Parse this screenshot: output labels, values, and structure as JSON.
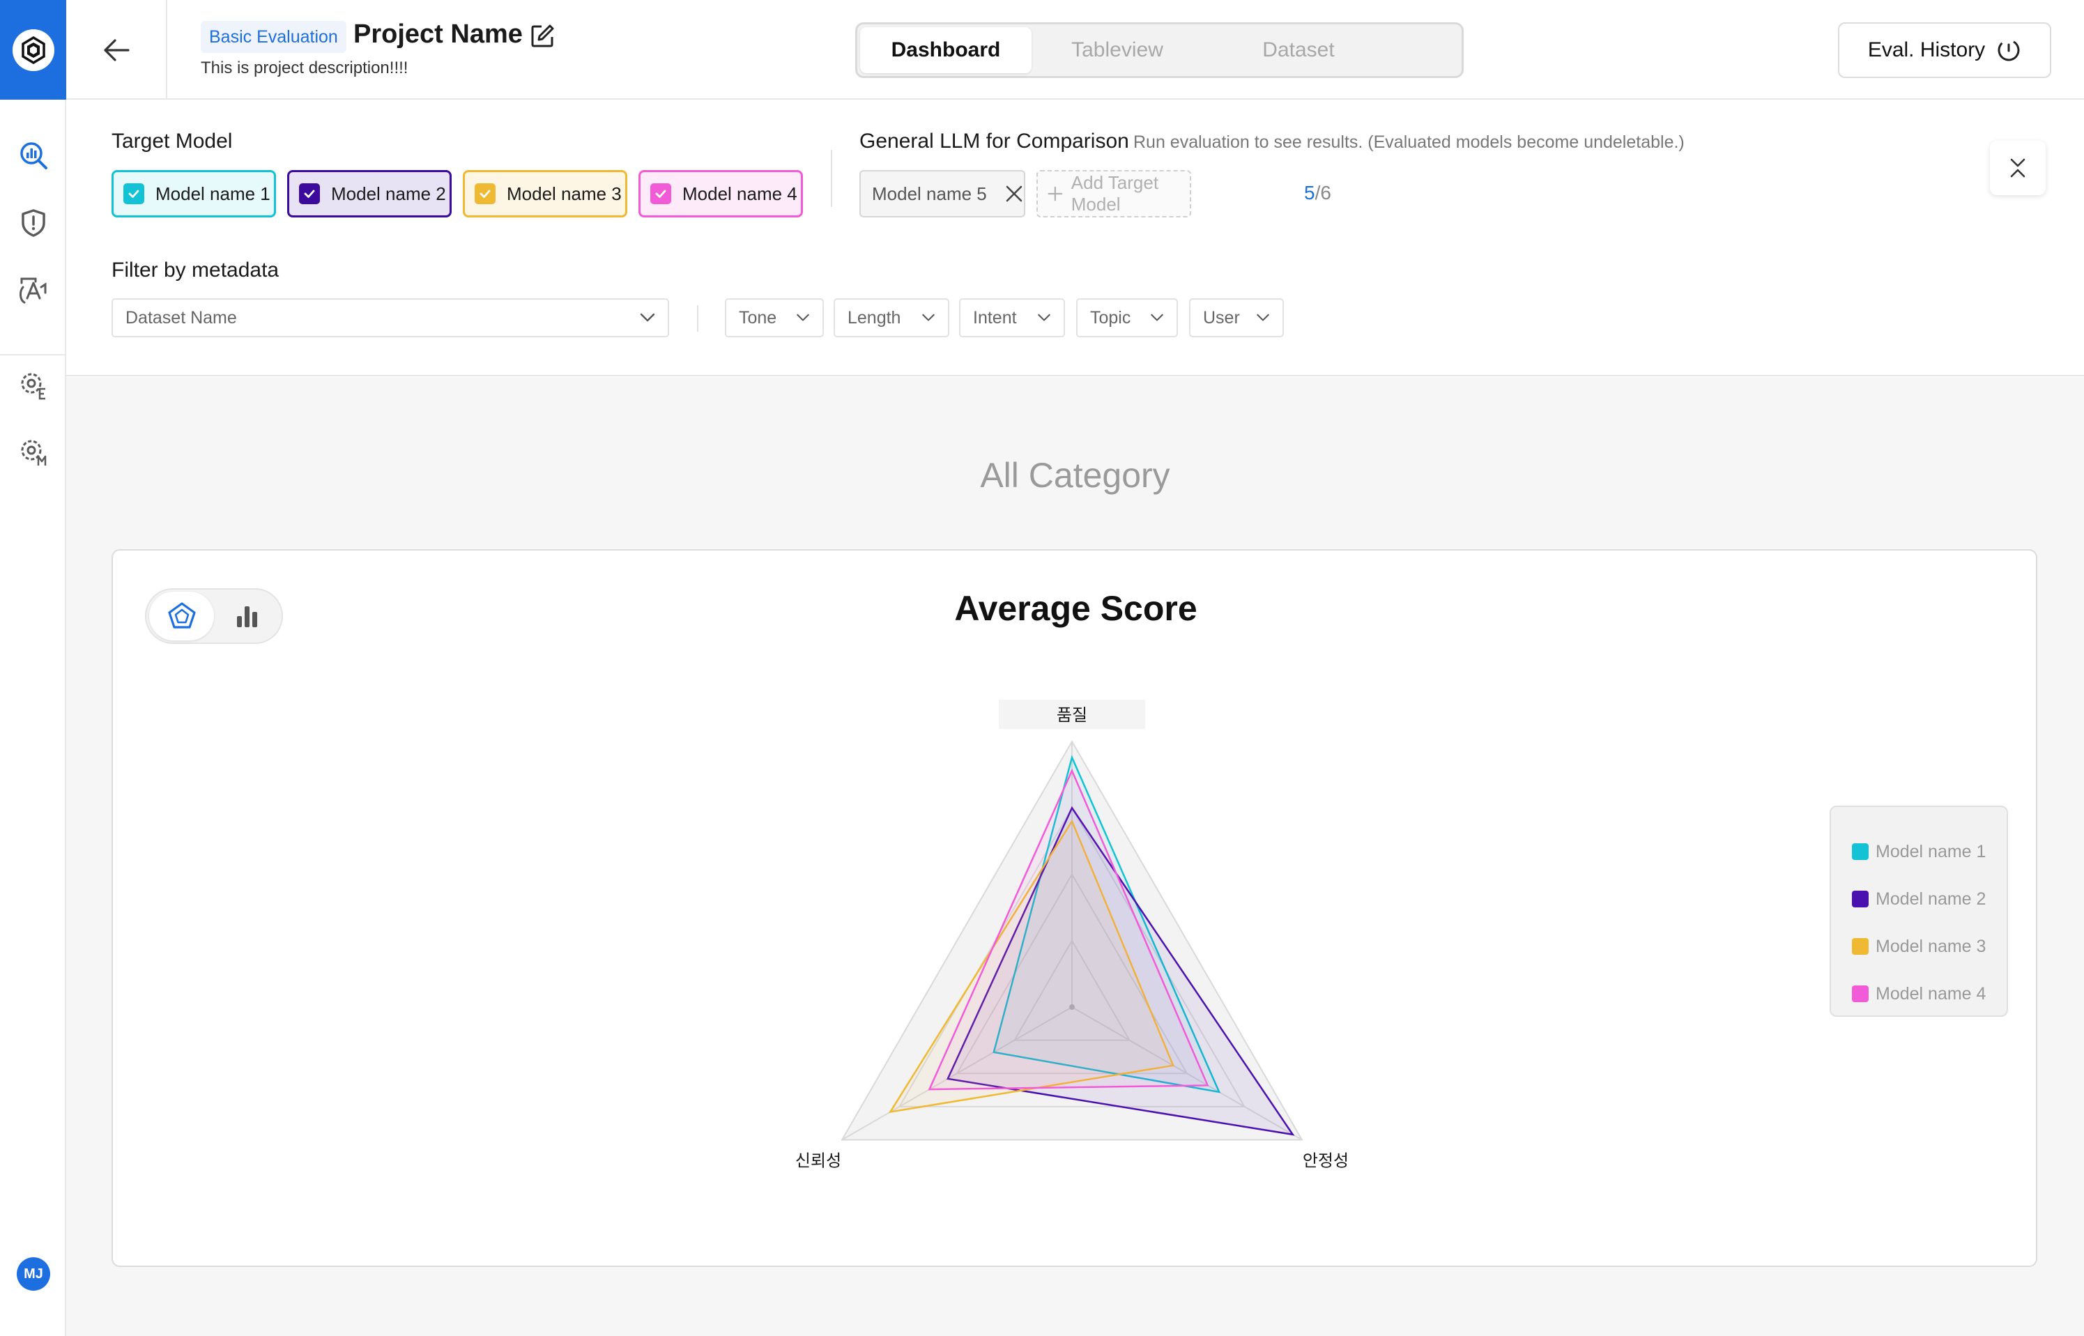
{
  "header": {
    "eval_type": "Basic Evaluation",
    "project_name": "Project Name",
    "project_description": "This is project description!!!!",
    "tabs": [
      {
        "label": "Dashboard",
        "active": true
      },
      {
        "label": "Tableview",
        "active": false
      },
      {
        "label": "Dataset",
        "active": false
      }
    ],
    "history_label": "Eval. History"
  },
  "sidebar": {
    "items": [
      {
        "icon": "analytics-icon",
        "active": true
      },
      {
        "icon": "shield-alert-icon",
        "active": false
      },
      {
        "icon": "translate-icon",
        "active": false
      },
      {
        "icon": "settings-e-icon",
        "active": false
      },
      {
        "icon": "settings-m-icon",
        "active": false
      }
    ],
    "user_initials": "MJ"
  },
  "target_model": {
    "label": "Target Model",
    "models": [
      {
        "name": "Model name 1",
        "checked": true,
        "color": "#13C2D4",
        "bg": "#E6F9FB"
      },
      {
        "name": "Model name 2",
        "checked": true,
        "color": "#3D0A9E",
        "bg": "#E8E2F5"
      },
      {
        "name": "Model name 3",
        "checked": true,
        "color": "#F0B933",
        "bg": "#FEF6E4"
      },
      {
        "name": "Model name 4",
        "checked": true,
        "color": "#F25BD8",
        "bg": "#FEEBFA"
      }
    ]
  },
  "comparison": {
    "label": "General LLM for Comparison",
    "hint": "Run evaluation to see results. (Evaluated models become undeletable.)",
    "models": [
      "Model name 5"
    ],
    "add_label": "Add Target Model",
    "count_current": "5",
    "count_total": "/6"
  },
  "filters": {
    "label": "Filter by metadata",
    "dataset_placeholder": "Dataset Name",
    "dropdowns": [
      "Tone",
      "Length",
      "Intent",
      "Topic",
      "User"
    ]
  },
  "content": {
    "category_title": "All Category"
  },
  "chart_data": {
    "type": "radar",
    "title": "Average Score",
    "axes": [
      "품질",
      "안정성",
      "신뢰성"
    ],
    "range": [
      0,
      100
    ],
    "series": [
      {
        "name": "Model name 1",
        "color": "#13C2D4",
        "values": [
          94,
          64,
          34
        ]
      },
      {
        "name": "Model name 2",
        "color": "#4A10B0",
        "values": [
          75,
          96,
          54
        ]
      },
      {
        "name": "Model name 3",
        "color": "#F0B933",
        "values": [
          70,
          44,
          79
        ]
      },
      {
        "name": "Model name 4",
        "color": "#F25BD8",
        "values": [
          89,
          59,
          62
        ]
      }
    ],
    "legend_position": "right"
  }
}
